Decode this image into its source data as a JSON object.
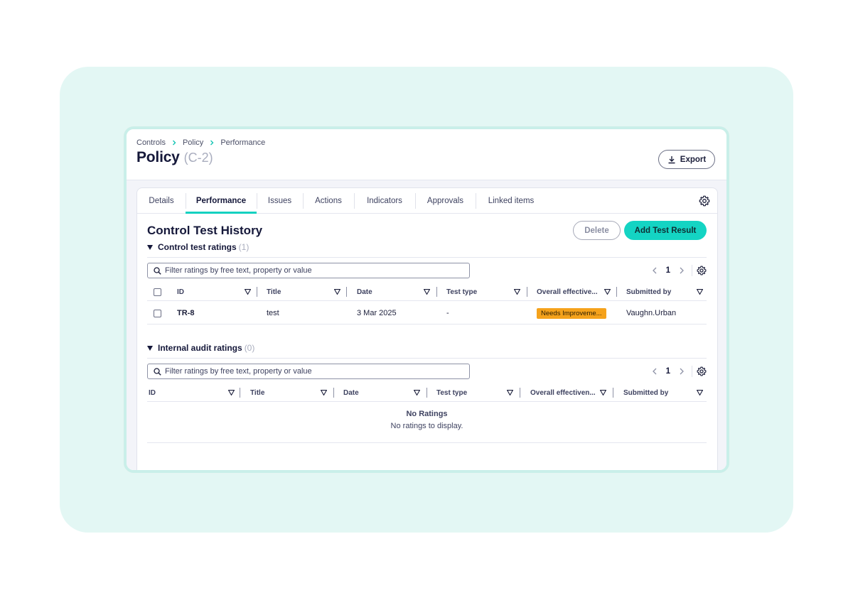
{
  "breadcrumb": [
    "Controls",
    "Policy",
    "Performance"
  ],
  "page": {
    "title": "Policy",
    "code": "(C-2)"
  },
  "header": {
    "export_label": "Export"
  },
  "tabs": [
    {
      "label": "Details",
      "active": false
    },
    {
      "label": "Performance",
      "active": true
    },
    {
      "label": "Issues",
      "active": false
    },
    {
      "label": "Actions",
      "active": false
    },
    {
      "label": "Indicators",
      "active": false
    },
    {
      "label": "Approvals",
      "active": false
    },
    {
      "label": "Linked items",
      "active": false
    }
  ],
  "section": {
    "title": "Control Test History",
    "delete_label": "Delete",
    "add_label": "Add Test Result"
  },
  "control_ratings": {
    "title": "Control test ratings",
    "count": "(1)",
    "filter_placeholder": "Filter ratings by free text, property or value",
    "page": "1",
    "columns": [
      "ID",
      "Title",
      "Date",
      "Test type",
      "Overall effective...",
      "Submitted by"
    ],
    "rows": [
      {
        "id": "TR-8",
        "title": "test",
        "date": "3 Mar 2025",
        "test_type": "-",
        "effectiveness": "Needs Improveme...",
        "submitted_by": "Vaughn.Urban"
      }
    ]
  },
  "audit_ratings": {
    "title": "Internal audit ratings",
    "count": "(0)",
    "filter_placeholder": "Filter ratings by free text, property or value",
    "page": "1",
    "columns": [
      "ID",
      "Title",
      "Date",
      "Test type",
      "Overall effectiven...",
      "Submitted by"
    ],
    "empty_title": "No Ratings",
    "empty_message": "No ratings to display."
  },
  "colors": {
    "accent": "#14d4c3",
    "badge_warning": "#f5a21b",
    "backdrop": "#e3f7f4"
  },
  "icons": [
    "chevron-right-icon",
    "download-icon",
    "gear-icon",
    "triangle-down-icon",
    "search-icon",
    "chevron-left-icon",
    "sort-icon"
  ]
}
